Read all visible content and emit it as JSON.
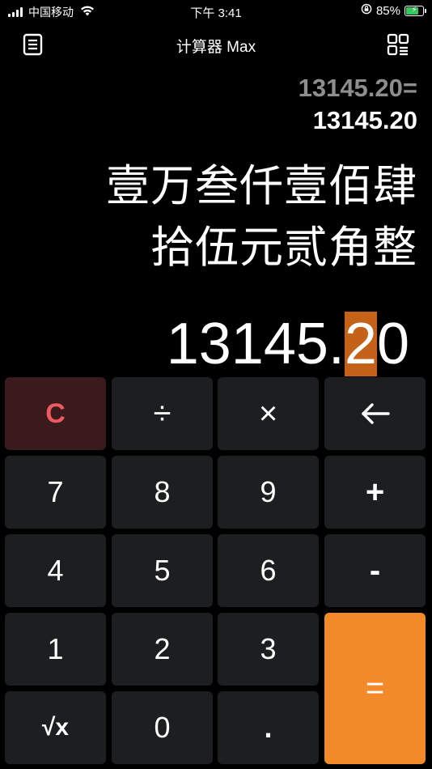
{
  "status_bar": {
    "carrier": "中国移动",
    "time": "下午 3:41",
    "battery_percent": "85%",
    "battery_level": 0.85,
    "battery_color": "#35c759"
  },
  "nav": {
    "title": "计算器 Max",
    "left_icon": "document-list-icon",
    "right_icon": "qr-grid-icon"
  },
  "display": {
    "expression": "13145.20=",
    "result": "13145.20",
    "chinese_line1": "壹万叁仟壹佰肆",
    "chinese_line2": "拾伍元贰角整",
    "main_before": "13145.",
    "main_selected": "2",
    "main_after": "0",
    "highlight_color": "#c4621a"
  },
  "keys": {
    "clear": "C",
    "divide": "÷",
    "multiply": "×",
    "backspace": "←",
    "seven": "7",
    "eight": "8",
    "nine": "9",
    "plus": "+",
    "four": "4",
    "five": "5",
    "six": "6",
    "minus": "-",
    "one": "1",
    "two": "2",
    "three": "3",
    "equals": "=",
    "sqrt": "√x",
    "zero": "0",
    "dot": "."
  },
  "colors": {
    "key_bg": "#1c1e20",
    "clear_bg": "#3a1a1d",
    "clear_text": "#ee5a5e",
    "equals_bg": "#f28a2a"
  }
}
